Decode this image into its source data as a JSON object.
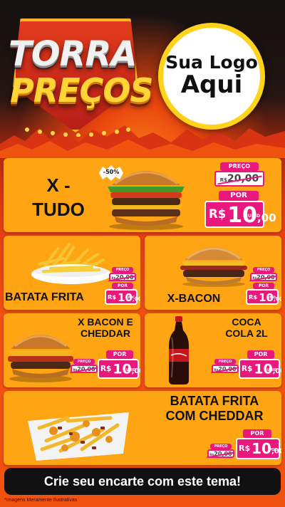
{
  "header": {
    "badge_line1": "TORRA",
    "badge_line2": "PREÇOS",
    "logo_line1": "Sua Logo",
    "logo_line2": "Aqui"
  },
  "products": {
    "xtudo": {
      "name_line1": "X -",
      "name_line2": "TUDO",
      "discount": "-50%",
      "old_label": "PREÇO",
      "old_currency": "R$",
      "old_value": "20,00",
      "new_label": "POR",
      "currency": "R$",
      "price_int": "10",
      "price_cents": ",00",
      "unit": "UNID"
    },
    "batata": {
      "name": "BATATA FRITA",
      "old_label": "PREÇO",
      "old_currency": "R$",
      "old_value": "20,00",
      "new_label": "POR",
      "currency": "R$",
      "price_int": "10",
      "price_cents": ",00",
      "unit": "POC"
    },
    "xbacon": {
      "name": "X-BACON",
      "old_label": "PREÇO",
      "old_currency": "R$",
      "old_value": "20,00",
      "new_label": "POR",
      "currency": "R$",
      "price_int": "10",
      "price_cents": ",00",
      "unit": "UNID"
    },
    "xbaconcheddar": {
      "name_line1": "X BACON E",
      "name_line2": "CHEDDAR",
      "old_label": "PREÇO",
      "old_currency": "R$",
      "old_value": "20,00",
      "new_label": "POR",
      "currency": "R$",
      "price_int": "10",
      "price_cents": ",00",
      "unit": "UNID"
    },
    "coca": {
      "name_line1": "COCA",
      "name_line2": "COLA 2L",
      "old_label": "PREÇO",
      "old_currency": "R$",
      "old_value": "20,00",
      "new_label": "POR",
      "currency": "R$",
      "price_int": "10",
      "price_cents": ",00",
      "unit": "UNID"
    },
    "batatacheddar": {
      "name_line1": "BATATA FRITA",
      "name_line2": "COM CHEDDAR",
      "old_label": "PREÇO",
      "old_currency": "R$",
      "old_value": "20,00",
      "new_label": "POR",
      "currency": "R$",
      "price_int": "10",
      "price_cents": ",00",
      "unit": "POC"
    }
  },
  "footer": {
    "cta": "Crie seu encarte com este tema!",
    "disclaimer": "*Imagens Meramente Ilustrativas"
  },
  "colors": {
    "accent_pink": "#e8187d",
    "card_orange": "#ffa514",
    "background_red": "#e03a12",
    "logo_ring": "#ffd21c"
  }
}
